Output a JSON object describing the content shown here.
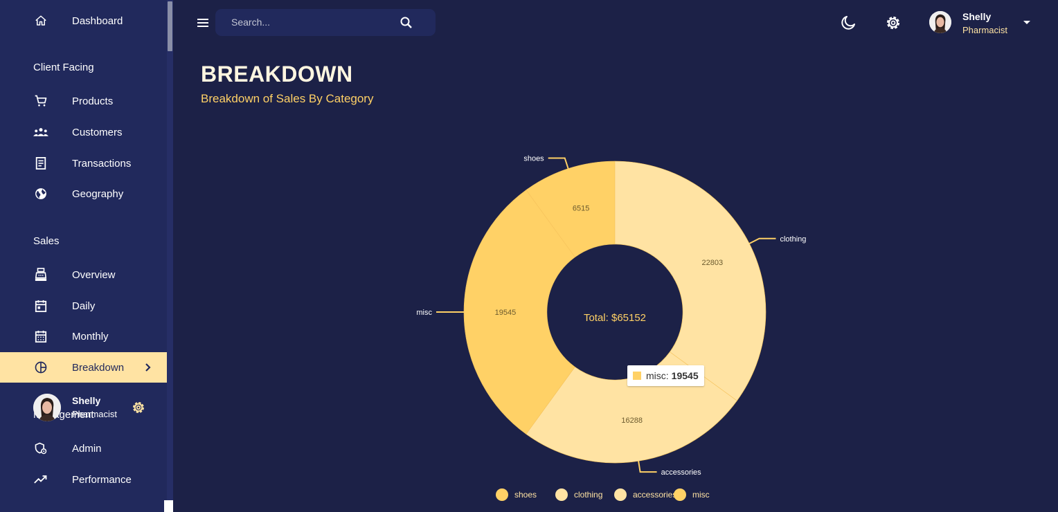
{
  "sidebar": {
    "items": [
      {
        "label": "Dashboard"
      },
      {
        "label": "Products"
      },
      {
        "label": "Customers"
      },
      {
        "label": "Transactions"
      },
      {
        "label": "Geography"
      },
      {
        "label": "Overview"
      },
      {
        "label": "Daily"
      },
      {
        "label": "Monthly"
      },
      {
        "label": "Breakdown"
      },
      {
        "label": "Admin"
      },
      {
        "label": "Performance"
      }
    ],
    "sections": [
      "Client Facing",
      "Sales",
      "Management"
    ],
    "user": {
      "name": "Shelly",
      "role": "Pharmacist"
    }
  },
  "topbar": {
    "search_placeholder": "Search...",
    "user": {
      "name": "Shelly",
      "role": "Pharmacist"
    }
  },
  "header": {
    "title": "BREAKDOWN",
    "subtitle": "Breakdown of Sales By Category"
  },
  "colors": {
    "background": "#1c2147",
    "sidebar": "#21295c",
    "accent": "#ffe3a3",
    "accent_strong": "#ffd166"
  },
  "chart_data": {
    "type": "pie",
    "inner_radius_ratio": 0.45,
    "categories": [
      "shoes",
      "clothing",
      "accessories",
      "misc"
    ],
    "values": [
      6515,
      22803,
      16288,
      19545
    ],
    "colors": [
      "#ffd166",
      "#ffe3a3",
      "#ffe3a3",
      "#ffd166"
    ],
    "center_label": "Total: $65152",
    "legend": {
      "placement": "bottom",
      "entries": [
        "shoes",
        "clothing",
        "accessories",
        "misc"
      ]
    },
    "tooltip": {
      "label": "misc:",
      "value": "19545"
    }
  }
}
